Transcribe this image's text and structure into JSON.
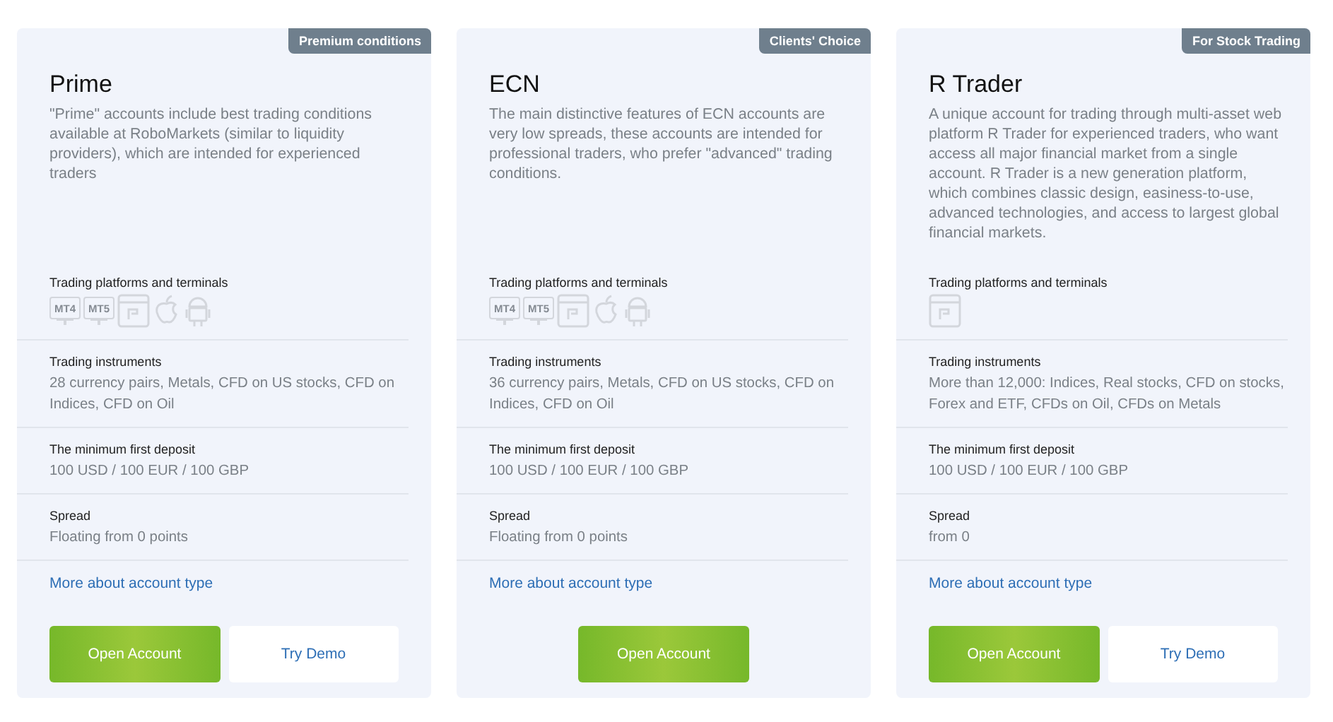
{
  "cards": [
    {
      "badge": "Premium conditions",
      "title": "Prime",
      "description": "\"Prime\" accounts include best trading conditions available at RoboMarkets (similar to liquidity providers), which are intended for experienced traders",
      "platforms_label": "Trading platforms and terminals",
      "platforms": [
        {
          "kind": "monitor",
          "label": "MT4"
        },
        {
          "kind": "monitor",
          "label": "MT5"
        },
        {
          "kind": "web"
        },
        {
          "kind": "apple"
        },
        {
          "kind": "android"
        }
      ],
      "sections": [
        {
          "label": "Trading instruments",
          "value": "28 currency pairs, Metals, CFD on US stocks, CFD on Indices, CFD on Oil"
        },
        {
          "label": "The minimum first deposit",
          "value": "100 USD / 100 EUR / 100 GBP"
        },
        {
          "label": "Spread",
          "value": "Floating from 0 points"
        }
      ],
      "link": "More about account type",
      "buttons": [
        {
          "kind": "primary",
          "label": "Open Account"
        },
        {
          "kind": "secondary",
          "label": "Try Demo"
        }
      ]
    },
    {
      "badge": "Clients' Choice",
      "title": "ECN",
      "description": "The main distinctive features of ECN accounts are very low spreads, these accounts are intended for professional traders, who prefer \"advanced\" trading conditions.",
      "platforms_label": "Trading platforms and terminals",
      "platforms": [
        {
          "kind": "monitor",
          "label": "MT4"
        },
        {
          "kind": "monitor",
          "label": "MT5"
        },
        {
          "kind": "web"
        },
        {
          "kind": "apple"
        },
        {
          "kind": "android"
        }
      ],
      "sections": [
        {
          "label": "Trading instruments",
          "value": "36 currency pairs, Metals, CFD on US stocks, CFD on Indices, CFD on Oil"
        },
        {
          "label": "The minimum first deposit",
          "value": "100 USD / 100 EUR / 100 GBP"
        },
        {
          "label": "Spread",
          "value": "Floating from 0 points"
        }
      ],
      "link": "More about account type",
      "buttons": [
        {
          "kind": "primary",
          "label": "Open Account"
        }
      ]
    },
    {
      "badge": "For Stock Trading",
      "title": "R Trader",
      "description": "A unique account for trading through multi-asset web platform R Trader for experienced traders, who want access all major financial market from a single account. R Trader is a new generation platform, which combines classic design, easiness-to-use, advanced technologies, and access to largest global financial markets.",
      "platforms_label": "Trading platforms and terminals",
      "platforms": [
        {
          "kind": "web"
        }
      ],
      "sections": [
        {
          "label": "Trading instruments",
          "value": "More than 12,000: Indices, Real stocks, CFD on stocks, Forex and ETF, CFDs on Oil, CFDs on Metals"
        },
        {
          "label": "The minimum first deposit",
          "value": "100 USD / 100 EUR / 100 GBP"
        },
        {
          "label": "Spread",
          "value": "from 0"
        }
      ],
      "link": "More about account type",
      "buttons": [
        {
          "kind": "primary",
          "label": "Open Account"
        },
        {
          "kind": "secondary",
          "label": "Try Demo"
        }
      ]
    }
  ]
}
